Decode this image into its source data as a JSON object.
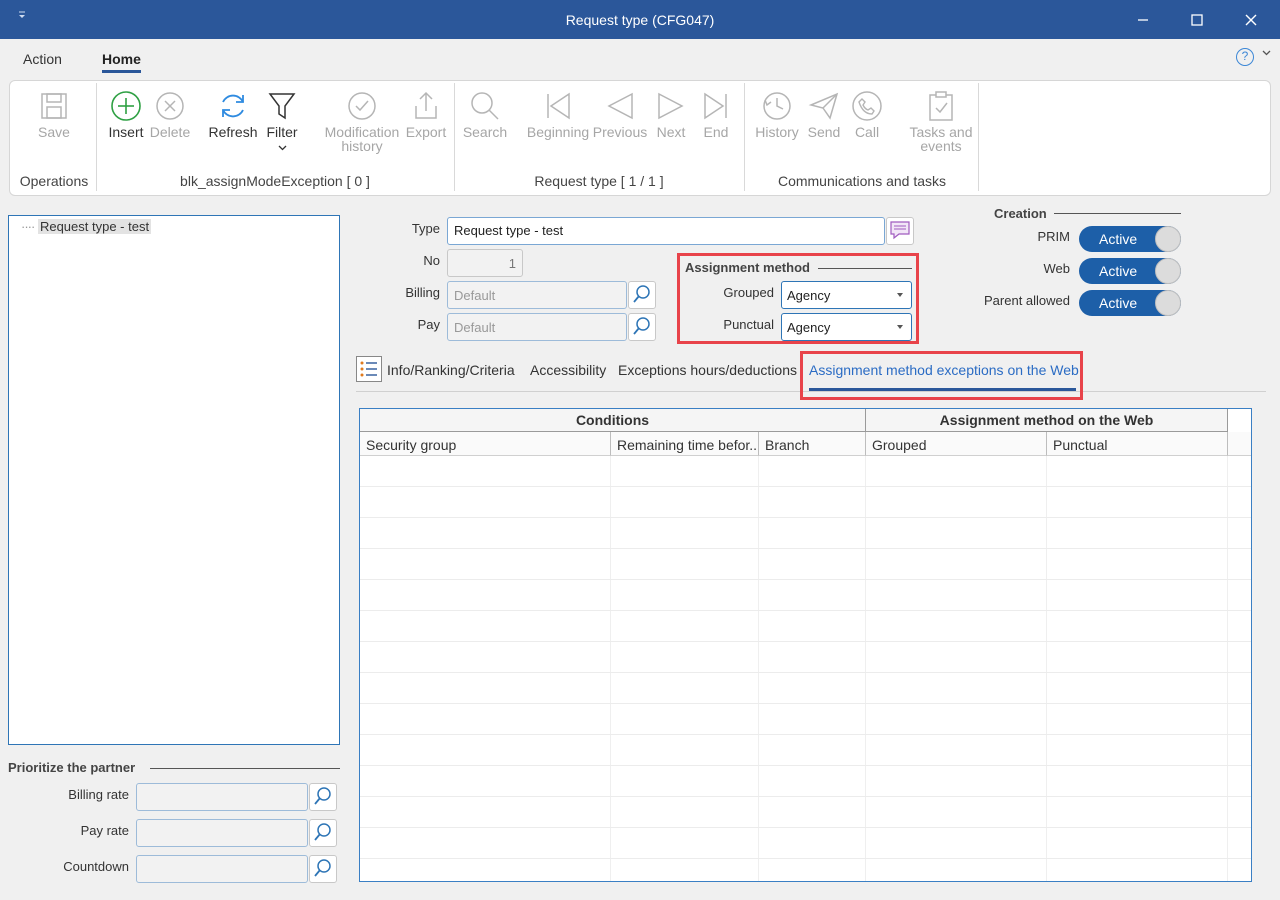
{
  "window": {
    "title": "Request type (CFG047)"
  },
  "menu": {
    "tabs": [
      "Action",
      "Home"
    ],
    "help_glyph": "?"
  },
  "ribbon": {
    "buttons": {
      "save": "Save",
      "insert": "Insert",
      "delete": "Delete",
      "refresh": "Refresh",
      "filter": "Filter",
      "mod_history_1": "Modification",
      "mod_history_2": "history",
      "export": "Export",
      "search": "Search",
      "beginning": "Beginning",
      "previous": "Previous",
      "next": "Next",
      "end": "End",
      "history": "History",
      "send": "Send",
      "call": "Call",
      "tasks_1": "Tasks and",
      "tasks_2": "events"
    },
    "groups": {
      "operations": "Operations",
      "block": "blk_assignModeException [ 0 ]",
      "request": "Request type [ 1 / 1 ]",
      "comms": "Communications and tasks"
    }
  },
  "tree": {
    "items": [
      {
        "label": "Request type - test"
      }
    ]
  },
  "partner": {
    "title": "Prioritize the partner",
    "billing_rate": "Billing rate",
    "pay_rate": "Pay rate",
    "countdown": "Countdown"
  },
  "form": {
    "type_label": "Type",
    "type_value": "Request type - test",
    "no_label": "No",
    "no_value": "1",
    "billing_label": "Billing",
    "billing_placeholder": "Default",
    "pay_label": "Pay",
    "pay_placeholder": "Default"
  },
  "assignment": {
    "title": "Assignment method",
    "grouped_label": "Grouped",
    "grouped_value": "Agency",
    "punctual_label": "Punctual",
    "punctual_value": "Agency"
  },
  "creation": {
    "title": "Creation",
    "prim_label": "PRIM",
    "prim_value": "Active",
    "web_label": "Web",
    "web_value": "Active",
    "parent_label": "Parent allowed",
    "parent_value": "Active"
  },
  "tabs": [
    "Info/Ranking/Criteria",
    "Accessibility",
    "Exceptions hours/deductions",
    "Assignment method exceptions on the Web"
  ],
  "grid": {
    "group_headers": [
      "Conditions",
      "Assignment method on the Web"
    ],
    "columns": [
      "Security group",
      "Remaining time befor...",
      "Branch",
      "Grouped",
      "Punctual"
    ],
    "rows": []
  },
  "colors": {
    "titlebar": "#2b579a",
    "accent": "#2b6cc4",
    "toggle": "#1d5fa8",
    "highlight": "#e8434a"
  }
}
